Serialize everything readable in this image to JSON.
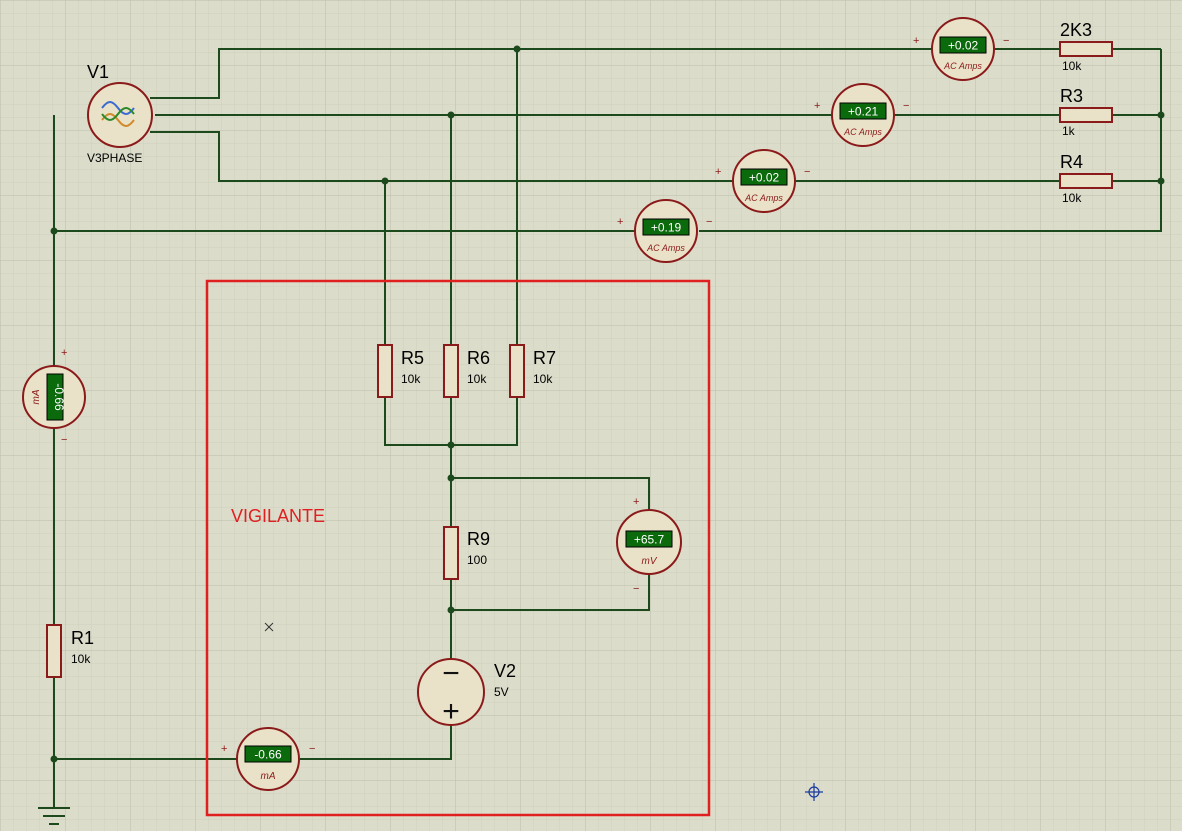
{
  "colors": {
    "background": "#dcdccb",
    "grid_minor": "#cfcfbd",
    "grid_major": "#bdbdab",
    "wire": "#1d4a1d",
    "component_fill": "#eae2c8",
    "component_stroke": "#8b1a1a",
    "display_bg": "#0b6a0b",
    "display_text": "#ffffff",
    "highlight_box": "#e02020",
    "highlight_text": "#e02020",
    "label_text": "#000000",
    "cursor": "#1a3aa0"
  },
  "source_v1": {
    "name": "V1",
    "type": "V3PHASE"
  },
  "source_v2": {
    "name": "V2",
    "value": "5V",
    "minus_sign": "−",
    "plus_sign": "+"
  },
  "resistors": {
    "r2k3": {
      "name": "2K3",
      "value": "10k"
    },
    "r3": {
      "name": "R3",
      "value": "1k"
    },
    "r4": {
      "name": "R4",
      "value": "10k"
    },
    "r5": {
      "name": "R5",
      "value": "10k"
    },
    "r6": {
      "name": "R6",
      "value": "10k"
    },
    "r7": {
      "name": "R7",
      "value": "10k"
    },
    "r9": {
      "name": "R9",
      "value": "100"
    },
    "r1": {
      "name": "R1",
      "value": "10k"
    }
  },
  "meters": {
    "ac1": {
      "reading": "+0.02",
      "unit": "AC Amps",
      "plus": "+",
      "minus": "−"
    },
    "ac2": {
      "reading": "+0.21",
      "unit": "AC Amps",
      "plus": "+",
      "minus": "−"
    },
    "ac3": {
      "reading": "+0.02",
      "unit": "AC Amps",
      "plus": "+",
      "minus": "−"
    },
    "ac4": {
      "reading": "+0.19",
      "unit": "AC Amps",
      "plus": "+",
      "minus": "−"
    },
    "ma_left": {
      "reading": "-0.66",
      "unit": "mA",
      "plus": "+",
      "minus": "−"
    },
    "mv": {
      "reading": "+65.7",
      "unit": "mV",
      "plus": "+",
      "minus": "−"
    },
    "ma_bottom": {
      "reading": "-0.66",
      "unit": "mA",
      "plus": "+",
      "minus": "−"
    }
  },
  "annotation": {
    "label": "VIGILANTE"
  }
}
